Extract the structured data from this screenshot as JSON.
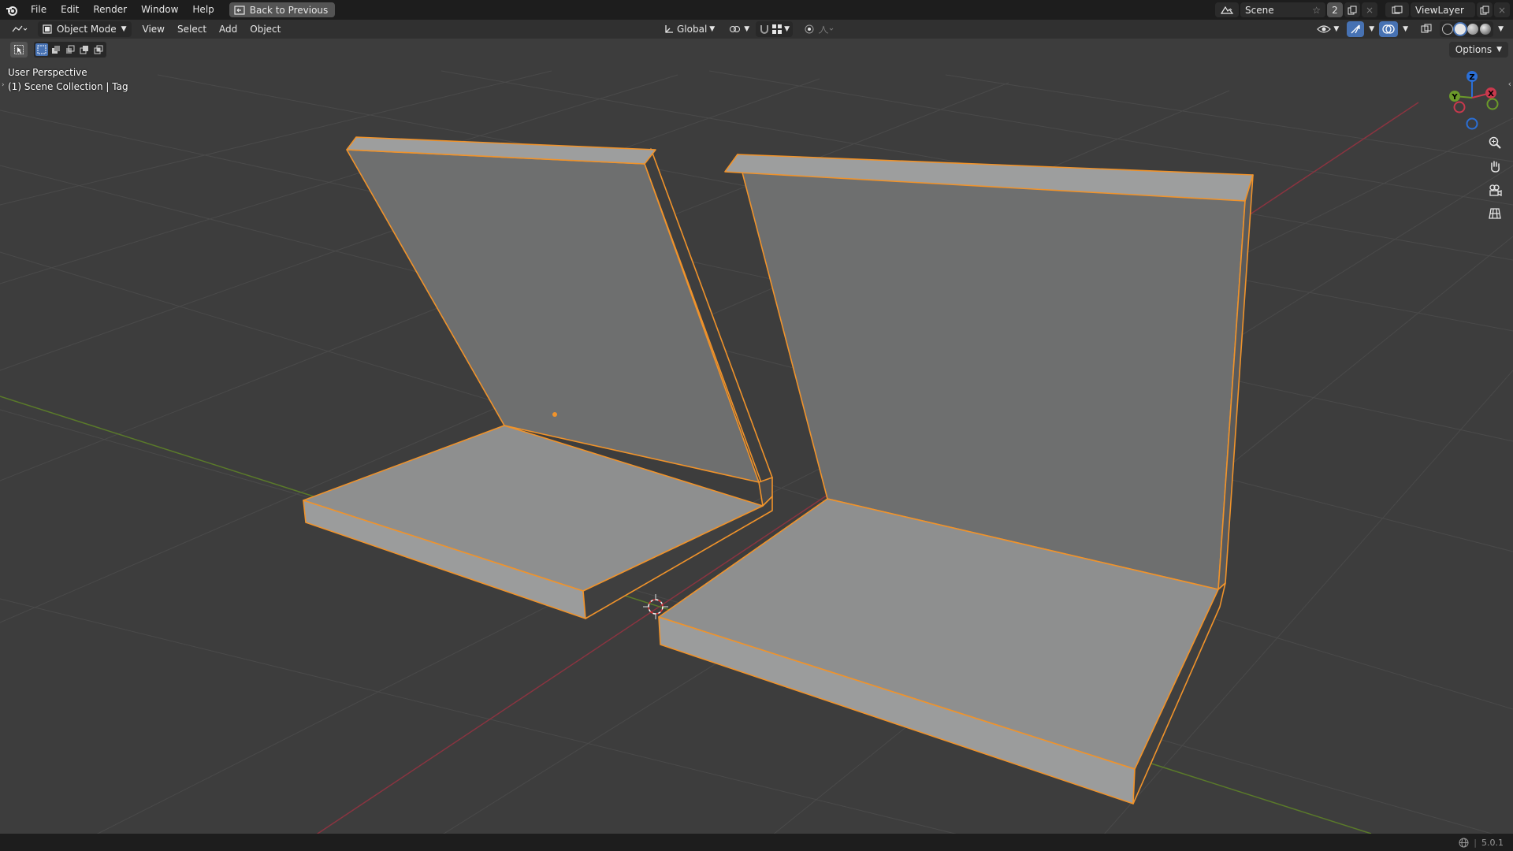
{
  "topbar": {
    "menus": [
      "File",
      "Edit",
      "Render",
      "Window",
      "Help"
    ],
    "back_label": "Back to Previous",
    "scene_name": "Scene",
    "scene_count": "2",
    "view_layer": "ViewLayer"
  },
  "header": {
    "mode": "Object Mode",
    "menus": [
      "View",
      "Select",
      "Add",
      "Object"
    ],
    "transform_orientation": "Global"
  },
  "toolrow": {
    "options_label": "Options"
  },
  "viewport": {
    "perspective": "User Perspective",
    "collection": "(1) Scene Collection | Tag",
    "gizmo_labels": {
      "z": "Z",
      "y": "Y",
      "x": "X"
    }
  },
  "statusbar": {
    "version": "5.0.1"
  },
  "colors": {
    "selection_outline": "#f0932b",
    "x_axis": "#c8394d",
    "y_axis": "#6b9a2a",
    "z_axis": "#2b6fd6",
    "active_blue": "#4772b3"
  }
}
